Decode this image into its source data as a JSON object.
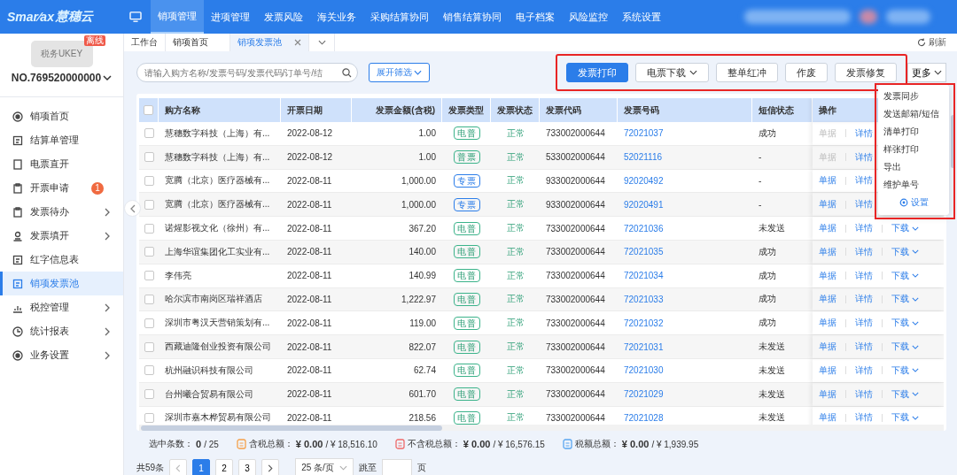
{
  "brand": {
    "name": "Smar⁄ax",
    "cn": "慧穗云"
  },
  "top_nav": [
    {
      "label": "销项管理",
      "selected": true
    },
    {
      "label": "进项管理",
      "selected": false
    },
    {
      "label": "发票风险",
      "selected": false
    },
    {
      "label": "海关业务",
      "selected": false
    },
    {
      "label": "采购结算协同",
      "selected": false
    },
    {
      "label": "销售结算协同",
      "selected": false
    },
    {
      "label": "电子档案",
      "selected": false
    },
    {
      "label": "风险监控",
      "selected": false
    },
    {
      "label": "系统设置",
      "selected": false
    }
  ],
  "ukey": {
    "label": "税务UKEY",
    "ribbon": "离线",
    "number": "NO.769520000000"
  },
  "sidebar": [
    {
      "label": "销项首页",
      "kind": "target",
      "selected": false,
      "has_children": false
    },
    {
      "label": "结算单管理",
      "kind": "doc",
      "selected": false,
      "has_children": false
    },
    {
      "label": "电票直开",
      "kind": "square",
      "selected": false,
      "has_children": false
    },
    {
      "label": "开票申请",
      "kind": "clip",
      "selected": false,
      "has_children": false,
      "badge": "1"
    },
    {
      "label": "发票待办",
      "kind": "clip",
      "selected": false,
      "has_children": true
    },
    {
      "label": "发票填开",
      "kind": "person",
      "selected": false,
      "has_children": true
    },
    {
      "label": "红字信息表",
      "kind": "doc",
      "selected": false,
      "has_children": false
    },
    {
      "label": "销项发票池",
      "kind": "doc",
      "selected": true,
      "has_children": false
    },
    {
      "label": "税控管理",
      "kind": "bars",
      "selected": false,
      "has_children": true
    },
    {
      "label": "统计报表",
      "kind": "clock",
      "selected": false,
      "has_children": true
    },
    {
      "label": "业务设置",
      "kind": "target",
      "selected": false,
      "has_children": true
    }
  ],
  "page_tabs": [
    {
      "label": "工作台",
      "selected": false,
      "closable": false
    },
    {
      "label": "销项首页",
      "selected": false,
      "closable": false
    },
    {
      "label": "销项发票池",
      "selected": true,
      "closable": true
    }
  ],
  "refresh": "刷新",
  "search": {
    "placeholder": "请输入购方名称/发票号码/发票代码/订单号/结"
  },
  "filter_button": "展开筛选",
  "toolbar": {
    "highlighted": true,
    "buttons": [
      {
        "label": "发票打印",
        "kind": "primary"
      },
      {
        "label": "电票下载",
        "kind": "dropdown"
      },
      {
        "label": "整单红冲",
        "kind": "plain"
      },
      {
        "label": "作废",
        "kind": "plain"
      },
      {
        "label": "发票修复",
        "kind": "plain"
      }
    ],
    "more": "更多"
  },
  "more_menu": {
    "highlighted": true,
    "items": [
      "发票同步",
      "发送邮箱/短信",
      "清单打印",
      "样张打印",
      "导出",
      "维护单号"
    ],
    "settings": "设置"
  },
  "table": {
    "all_selected": false,
    "columns": [
      "购方名称",
      "开票日期",
      "发票金额(含税)",
      "发票类型",
      "发票状态",
      "发票代码",
      "发票号码",
      "短信状态",
      "操作"
    ],
    "rows": [
      {
        "buyer": "慧穗数字科技（上海）有...",
        "date": "2022-08-12",
        "amount": "1.00",
        "type": "电普",
        "kind": "general",
        "status": "正常",
        "code": "733002000644",
        "number": "72021037",
        "sms": "成功",
        "doc": "单据",
        "doc_disabled": true,
        "detail": "详情",
        "selected": false
      },
      {
        "buyer": "慧穗数字科技（上海）有...",
        "date": "2022-08-12",
        "amount": "1.00",
        "type": "普票",
        "kind": "general",
        "status": "正常",
        "code": "533002000644",
        "number": "52021116",
        "sms": "-",
        "doc": "单据",
        "doc_disabled": true,
        "detail": "详情",
        "selected": false
      },
      {
        "buyer": "宽腾（北京）医疗器械有...",
        "date": "2022-08-11",
        "amount": "1,000.00",
        "type": "专票",
        "kind": "special",
        "status": "正常",
        "code": "933002000644",
        "number": "92020492",
        "sms": "-",
        "doc": "单据",
        "doc_disabled": false,
        "detail": "详情",
        "selected": false
      },
      {
        "buyer": "宽腾（北京）医疗器械有...",
        "date": "2022-08-11",
        "amount": "1,000.00",
        "type": "专票",
        "kind": "special",
        "status": "正常",
        "code": "933002000644",
        "number": "92020491",
        "sms": "-",
        "doc": "单据",
        "doc_disabled": false,
        "detail": "详情",
        "selected": false
      },
      {
        "buyer": "诺煋影视文化（徐州）有...",
        "date": "2022-08-11",
        "amount": "367.20",
        "type": "电普",
        "kind": "general",
        "status": "正常",
        "code": "733002000644",
        "number": "72021036",
        "sms": "未发送",
        "doc": "单据",
        "doc_disabled": false,
        "detail": "详情",
        "download": "下载",
        "selected": false
      },
      {
        "buyer": "上海华谊集团化工实业有...",
        "date": "2022-08-11",
        "amount": "140.00",
        "type": "电普",
        "kind": "general",
        "status": "正常",
        "code": "733002000644",
        "number": "72021035",
        "sms": "成功",
        "doc": "单据",
        "doc_disabled": false,
        "detail": "详情",
        "download": "下载",
        "selected": false
      },
      {
        "buyer": "李伟亮",
        "date": "2022-08-11",
        "amount": "140.99",
        "type": "电普",
        "kind": "general",
        "status": "正常",
        "code": "733002000644",
        "number": "72021034",
        "sms": "成功",
        "doc": "单据",
        "doc_disabled": false,
        "detail": "详情",
        "download": "下载",
        "selected": false
      },
      {
        "buyer": "哈尔滨市南岗区瑞祥酒店",
        "date": "2022-08-11",
        "amount": "1,222.97",
        "type": "电普",
        "kind": "general",
        "status": "正常",
        "code": "733002000644",
        "number": "72021033",
        "sms": "成功",
        "doc": "单据",
        "doc_disabled": false,
        "detail": "详情",
        "download": "下载",
        "selected": false
      },
      {
        "buyer": "深圳市粤汉天营销策划有...",
        "date": "2022-08-11",
        "amount": "119.00",
        "type": "电普",
        "kind": "general",
        "status": "正常",
        "code": "733002000644",
        "number": "72021032",
        "sms": "成功",
        "doc": "单据",
        "doc_disabled": false,
        "detail": "详情",
        "download": "下载",
        "selected": false
      },
      {
        "buyer": "西藏迪隆创业投资有限公司",
        "date": "2022-08-11",
        "amount": "822.07",
        "type": "电普",
        "kind": "general",
        "status": "正常",
        "code": "733002000644",
        "number": "72021031",
        "sms": "未发送",
        "doc": "单据",
        "doc_disabled": false,
        "detail": "详情",
        "download": "下载",
        "selected": false
      },
      {
        "buyer": "杭州融识科技有限公司",
        "date": "2022-08-11",
        "amount": "62.74",
        "type": "电普",
        "kind": "general",
        "status": "正常",
        "code": "733002000644",
        "number": "72021030",
        "sms": "未发送",
        "doc": "单据",
        "doc_disabled": false,
        "detail": "详情",
        "download": "下载",
        "selected": false
      },
      {
        "buyer": "台州曦合贸易有限公司",
        "date": "2022-08-11",
        "amount": "601.70",
        "type": "电普",
        "kind": "general",
        "status": "正常",
        "code": "733002000644",
        "number": "72021029",
        "sms": "未发送",
        "doc": "单据",
        "doc_disabled": false,
        "detail": "详情",
        "download": "下载",
        "selected": false
      },
      {
        "buyer": "深圳市嘉木桦贸易有限公司",
        "date": "2022-08-11",
        "amount": "218.56",
        "type": "电普",
        "kind": "general",
        "status": "正常",
        "code": "733002000644",
        "number": "72021028",
        "sms": "未发送",
        "doc": "单据",
        "doc_disabled": false,
        "detail": "详情",
        "download": "下载",
        "selected": false
      }
    ]
  },
  "summary": [
    {
      "label": "选中条数：",
      "selected": "0",
      "total": "/ 25",
      "kind": "none"
    },
    {
      "label": "含税总额：",
      "selected": "¥ 0.00",
      "total": "/ ¥ 18,516.10",
      "kind": "orange"
    },
    {
      "label": "不含税总额：",
      "selected": "¥ 0.00",
      "total": "/ ¥ 16,576.15",
      "kind": "red"
    },
    {
      "label": "税额总额：",
      "selected": "¥ 0.00",
      "total": "/ ¥ 1,939.95",
      "kind": "blue"
    }
  ],
  "pagination": {
    "total": "共59条",
    "pages": [
      {
        "label": "1",
        "selected": true
      },
      {
        "label": "2",
        "selected": false
      },
      {
        "label": "3",
        "selected": false
      }
    ],
    "page_size": "25 条/页",
    "jump_label": "跳至",
    "page_unit": "页"
  }
}
